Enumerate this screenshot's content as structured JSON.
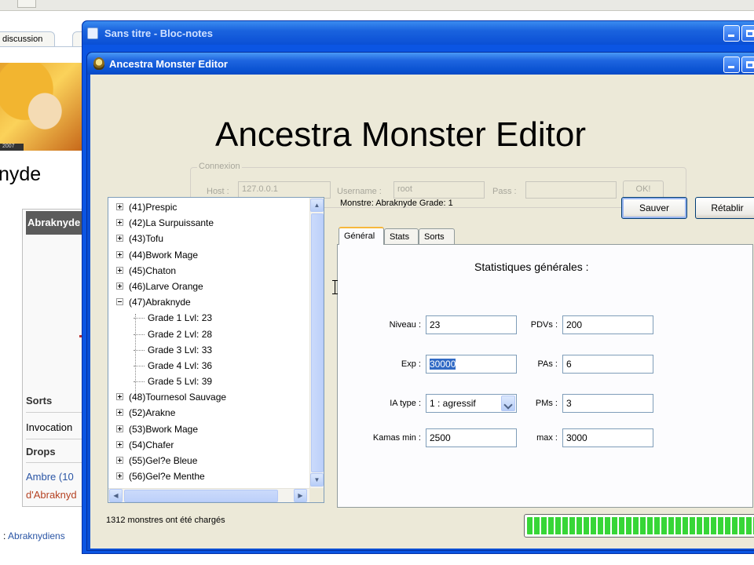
{
  "background": {
    "tab_label": "discussion",
    "page_heading": "nyde",
    "infobox": {
      "header": "Abraknyde",
      "rows": [
        {
          "text": "Sorts",
          "bold": true
        },
        {
          "text": "Invocation",
          "bold": false
        },
        {
          "text": "Drops",
          "bold": true
        },
        {
          "text": "Ambre (10",
          "link": true
        },
        {
          "text": "d'Abraknyd",
          "link2": true
        }
      ]
    },
    "footer": {
      "prefix": ": ",
      "link": "Abraknydiens"
    },
    "avatar_caption": "2007"
  },
  "notepad": {
    "title": "Sans titre - Bloc-notes"
  },
  "editor": {
    "title": "Ancestra Monster Editor",
    "heading": "Ancestra Monster Editor",
    "connection": {
      "legend": "Connexion",
      "host_label": "Host :",
      "host_value": "127.0.0.1",
      "username_label": "Username :",
      "username_value": "root",
      "pass_label": "Pass :",
      "pass_value": "",
      "ok_label": "OK!"
    },
    "tree": {
      "items": [
        {
          "label": "(41)Prespic",
          "type": "node",
          "expanded": false
        },
        {
          "label": "(42)La Surpuissante",
          "type": "node",
          "expanded": false
        },
        {
          "label": "(43)Tofu",
          "type": "node",
          "expanded": false
        },
        {
          "label": "(44)Bwork Mage",
          "type": "node",
          "expanded": false
        },
        {
          "label": "(45)Chaton",
          "type": "node",
          "expanded": false
        },
        {
          "label": "(46)Larve Orange",
          "type": "node",
          "expanded": false
        },
        {
          "label": "(47)Abraknyde",
          "type": "node",
          "expanded": true
        },
        {
          "label": "Grade 1 Lvl: 23",
          "type": "child"
        },
        {
          "label": "Grade 2 Lvl: 28",
          "type": "child"
        },
        {
          "label": "Grade 3 Lvl: 33",
          "type": "child"
        },
        {
          "label": "Grade 4 Lvl: 36",
          "type": "child"
        },
        {
          "label": "Grade 5 Lvl: 39",
          "type": "child"
        },
        {
          "label": "(48)Tournesol Sauvage",
          "type": "node",
          "expanded": false
        },
        {
          "label": "(52)Arakne",
          "type": "node",
          "expanded": false
        },
        {
          "label": "(53)Bwork Mage",
          "type": "node",
          "expanded": false
        },
        {
          "label": "(54)Chafer",
          "type": "node",
          "expanded": false
        },
        {
          "label": "(55)Gel?e Bleue",
          "type": "node",
          "expanded": false
        },
        {
          "label": "(56)Gel?e Menthe",
          "type": "node",
          "expanded": false
        }
      ]
    },
    "monster_label": "Monstre: Abraknyde Grade: 1",
    "save_label": "Sauver",
    "reset_label": "Rétablir",
    "tabs": [
      "Général",
      "Stats",
      "Sorts"
    ],
    "active_tab": "Général",
    "general": {
      "heading": "Statistiques générales :",
      "niveau_label": "Niveau :",
      "niveau_value": "23",
      "pdvs_label": "PDVs :",
      "pdvs_value": "200",
      "exp_label": "Exp :",
      "exp_value": "30000",
      "pas_label": "PAs :",
      "pas_value": "6",
      "ia_label": "IA type :",
      "ia_value": "1 : agressif",
      "pms_label": "PMs :",
      "pms_value": "3",
      "kamas_min_label": "Kamas min :",
      "kamas_min_value": "2500",
      "max_label": "max :",
      "max_value": "3000"
    },
    "status_text": "1312 monstres ont été chargés",
    "progress": 1.0
  },
  "colors": {
    "xp_blue": "#0a4fd5",
    "face": "#ece9d8",
    "progress_green": "#37d637",
    "selection": "#316ac5"
  }
}
